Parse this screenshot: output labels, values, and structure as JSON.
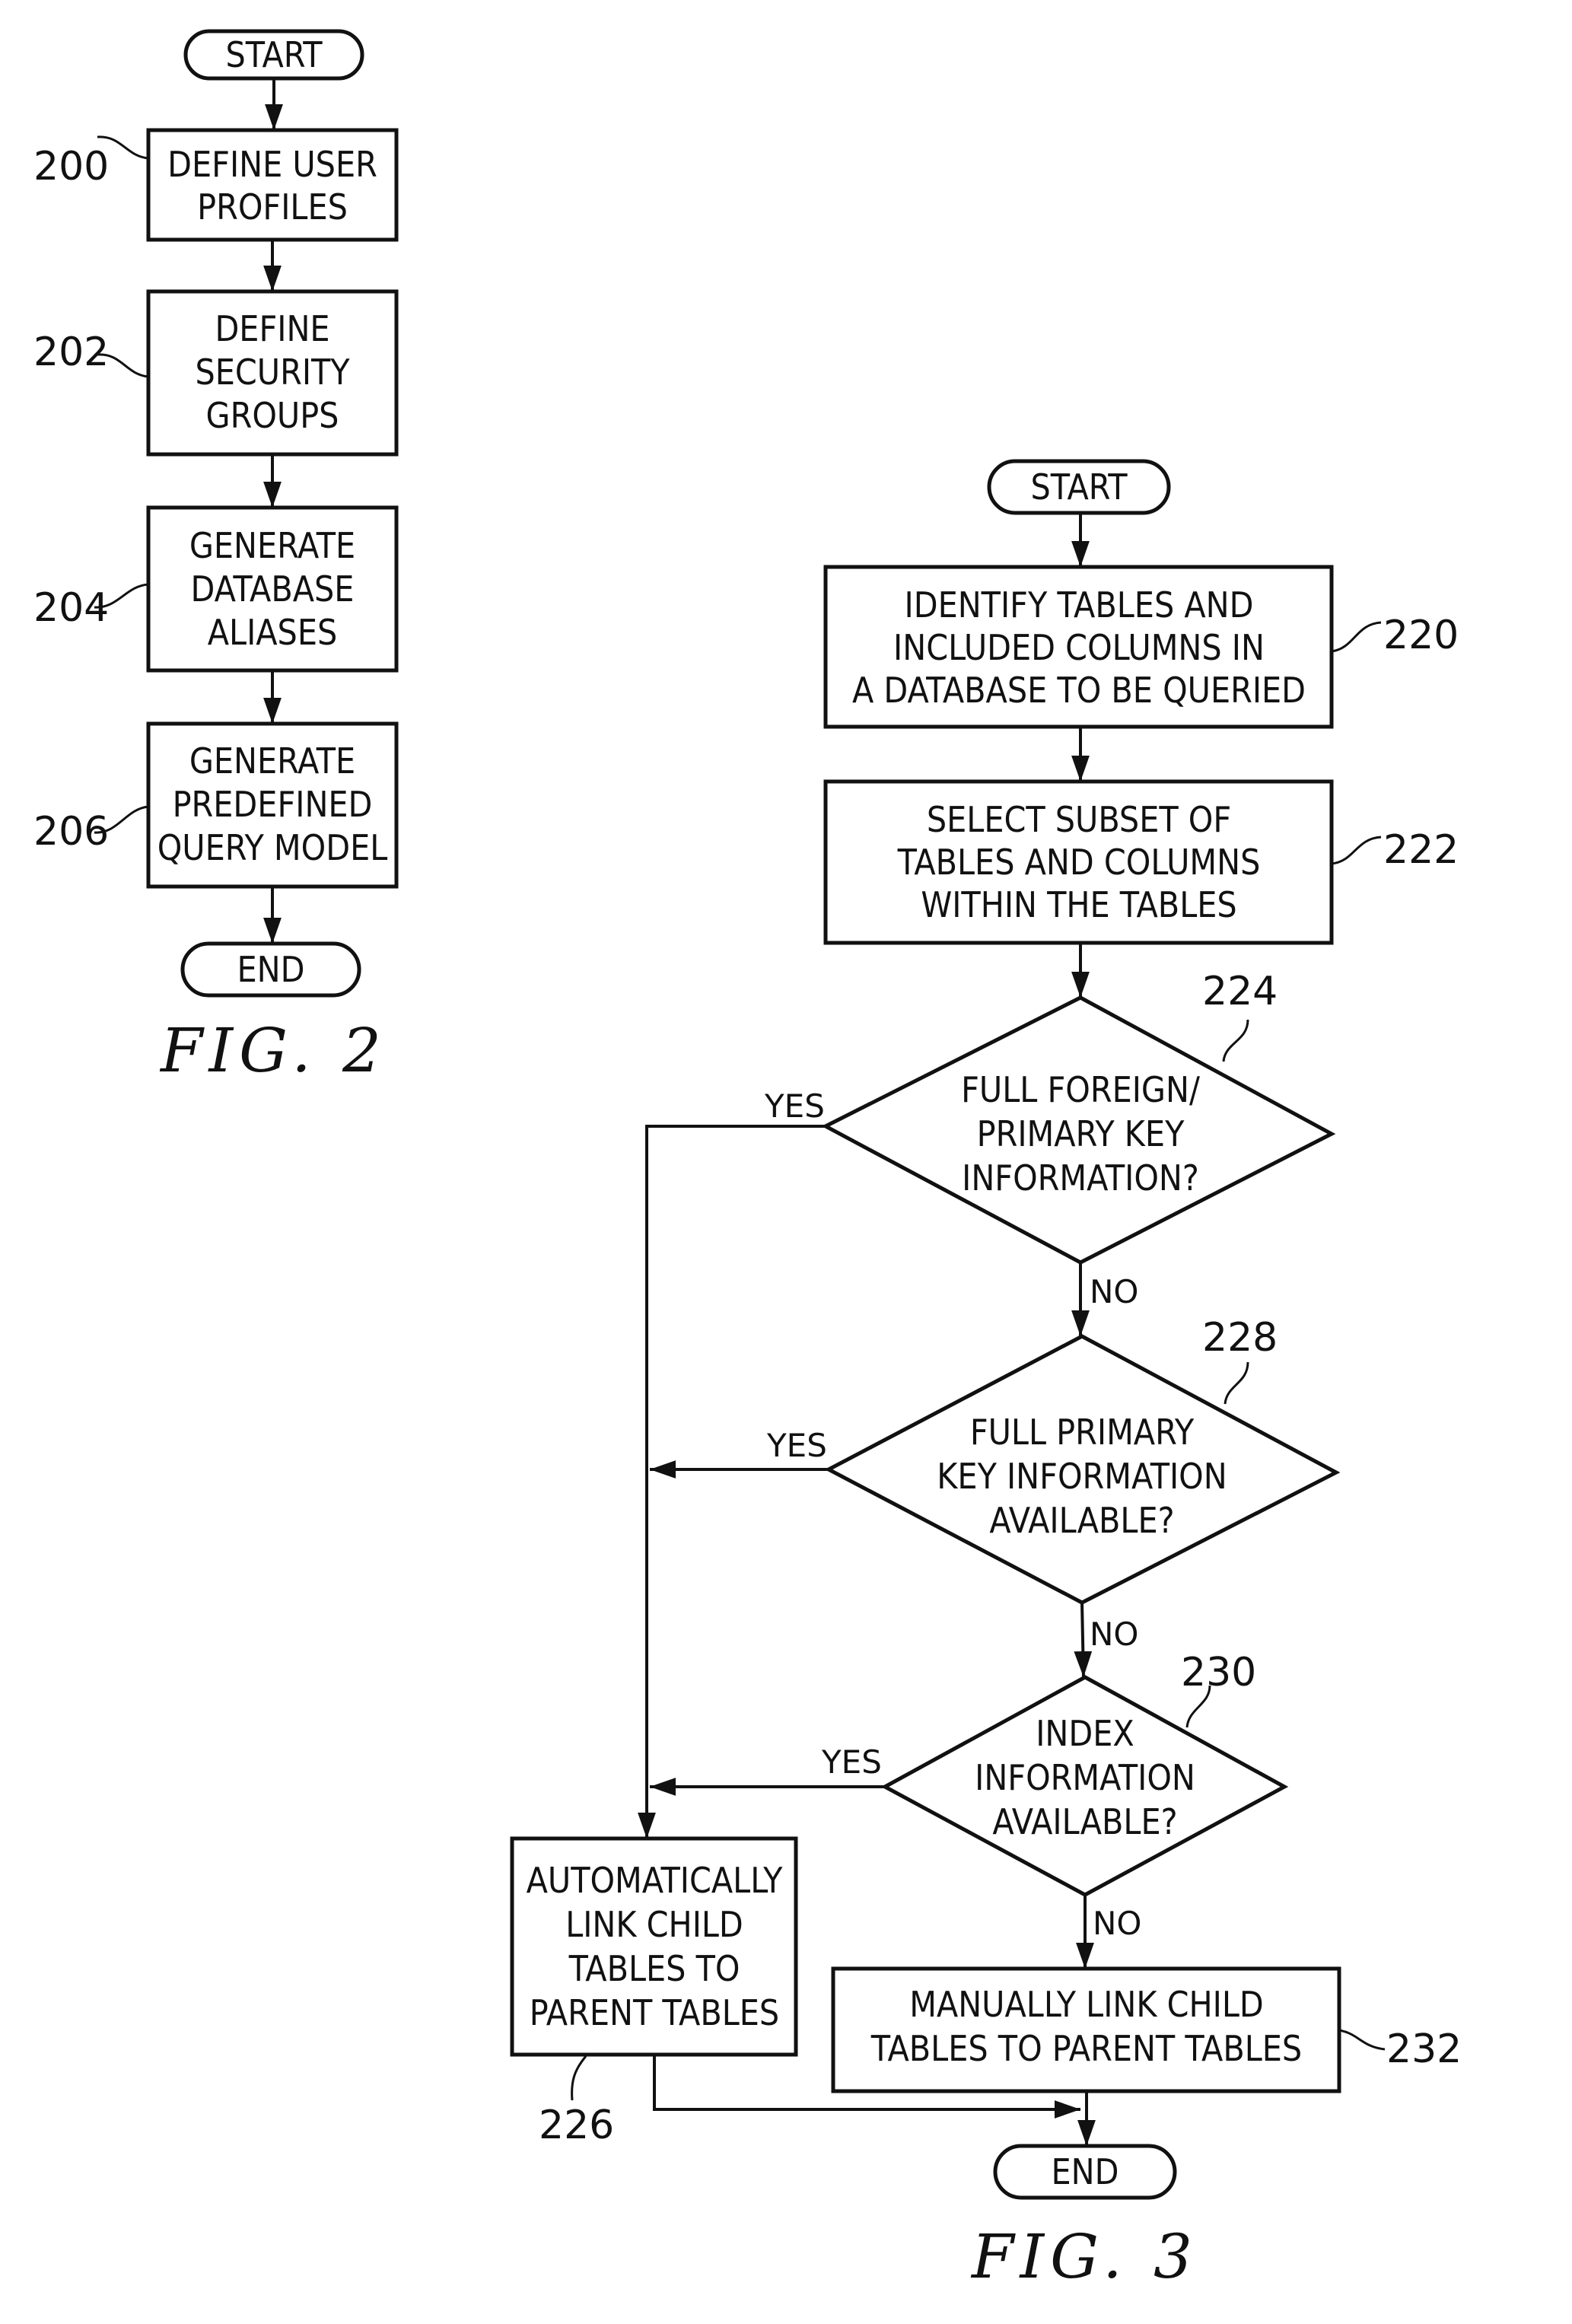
{
  "figure2": {
    "caption": "FIG. 2",
    "start_label": "START",
    "end_label": "END",
    "steps": [
      {
        "ref": "200",
        "lines": [
          "DEFINE USER",
          "PROFILES"
        ]
      },
      {
        "ref": "202",
        "lines": [
          "DEFINE",
          "SECURITY",
          "GROUPS"
        ]
      },
      {
        "ref": "204",
        "lines": [
          "GENERATE",
          "DATABASE",
          "ALIASES"
        ]
      },
      {
        "ref": "206",
        "lines": [
          "GENERATE",
          "PREDEFINED",
          "QUERY MODEL"
        ]
      }
    ]
  },
  "figure3": {
    "caption": "FIG. 3",
    "start_label": "START",
    "end_label": "END",
    "steps": [
      {
        "ref": "220",
        "lines": [
          "IDENTIFY TABLES AND",
          "INCLUDED COLUMNS IN",
          "A DATABASE TO BE QUERIED"
        ]
      },
      {
        "ref": "222",
        "lines": [
          "SELECT SUBSET OF",
          "TABLES AND COLUMNS",
          "WITHIN THE TABLES"
        ]
      }
    ],
    "decisions": [
      {
        "ref": "224",
        "lines": [
          "FULL FOREIGN/",
          "PRIMARY KEY",
          "INFORMATION?"
        ],
        "yes_label": "YES",
        "no_label": "NO"
      },
      {
        "ref": "228",
        "lines": [
          "FULL PRIMARY",
          "KEY INFORMATION",
          "AVAILABLE?"
        ],
        "yes_label": "YES",
        "no_label": "NO"
      },
      {
        "ref": "230",
        "lines": [
          "INDEX",
          "INFORMATION",
          "AVAILABLE?"
        ],
        "yes_label": "YES",
        "no_label": "NO"
      }
    ],
    "auto_link": {
      "ref": "226",
      "lines": [
        "AUTOMATICALLY",
        "LINK CHILD",
        "TABLES TO",
        "PARENT TABLES"
      ]
    },
    "manual_link": {
      "ref": "232",
      "lines": [
        "MANUALLY LINK CHILD",
        "TABLES TO PARENT TABLES"
      ]
    }
  }
}
